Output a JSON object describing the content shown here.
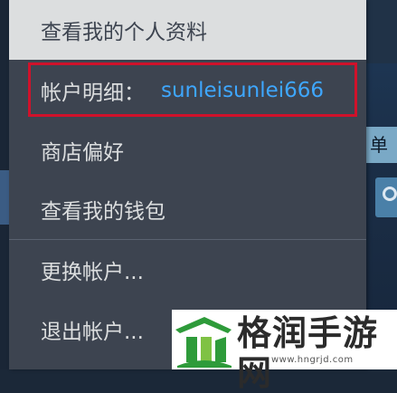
{
  "menu": {
    "items": [
      {
        "label": "查看我的个人资料",
        "highlighted": true
      },
      {
        "label": "帐户明细：",
        "value": "sunleisunlei666"
      },
      {
        "label": "商店偏好"
      },
      {
        "label": "查看我的钱包"
      },
      {
        "label": "更换帐户..."
      },
      {
        "label": "退出帐户..."
      }
    ]
  },
  "background": {
    "tab_char": "单"
  },
  "watermark": {
    "title": "格润手游网",
    "url": "www.hngrjd.com"
  },
  "colors": {
    "menu_bg": "#3d4450",
    "menu_text": "#dcdedf",
    "highlight_bg": "#dcdedf",
    "account_name": "#3ea7ff",
    "annotation": "#d0122b",
    "logo_green": "#2e9b3a"
  }
}
